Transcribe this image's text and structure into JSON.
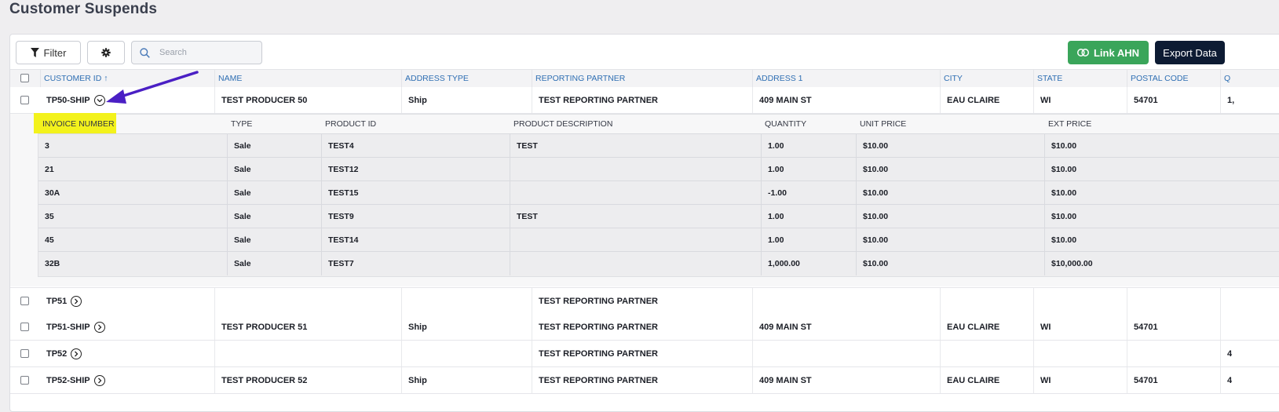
{
  "page": {
    "title": "Customer Suspends"
  },
  "toolbar": {
    "filter_label": "Filter",
    "search_placeholder": "Search",
    "link_label": "Link AHN",
    "export_label": "Export Data",
    "accent_green": "#3aa55a",
    "accent_navy": "#0d1b33"
  },
  "table": {
    "columns": [
      "CUSTOMER ID ↑",
      "NAME",
      "ADDRESS TYPE",
      "REPORTING PARTNER",
      "ADDRESS 1",
      "CITY",
      "STATE",
      "POSTAL CODE",
      "Q"
    ],
    "rows": [
      {
        "customer_id": "TP50-SHIP",
        "name": "TEST PRODUCER 50",
        "address_type": "Ship",
        "partner": "TEST REPORTING PARTNER",
        "address1": "409 MAIN ST",
        "city": "EAU CLAIRE",
        "state": "WI",
        "postal": "54701",
        "extra": "1,"
      },
      {
        "customer_id": "TP51",
        "name": "",
        "address_type": "",
        "partner": "TEST REPORTING PARTNER",
        "address1": "",
        "city": "",
        "state": "",
        "postal": "",
        "extra": ""
      },
      {
        "customer_id": "TP51-SHIP",
        "name": "TEST PRODUCER 51",
        "address_type": "Ship",
        "partner": "TEST REPORTING PARTNER",
        "address1": "409 MAIN ST",
        "city": "EAU CLAIRE",
        "state": "WI",
        "postal": "54701",
        "extra": ""
      },
      {
        "customer_id": "TP52",
        "name": "",
        "address_type": "",
        "partner": "TEST REPORTING PARTNER",
        "address1": "",
        "city": "",
        "state": "",
        "postal": "",
        "extra": "4"
      },
      {
        "customer_id": "TP52-SHIP",
        "name": "TEST PRODUCER 52",
        "address_type": "Ship",
        "partner": "TEST REPORTING PARTNER",
        "address1": "409 MAIN ST",
        "city": "EAU CLAIRE",
        "state": "WI",
        "postal": "54701",
        "extra": "4"
      }
    ]
  },
  "subtable": {
    "columns": [
      "INVOICE NUMBER",
      "TYPE",
      "PRODUCT ID",
      "PRODUCT DESCRIPTION",
      "QUANTITY",
      "UNIT PRICE",
      "EXT PRICE"
    ],
    "rows": [
      [
        "3",
        "Sale",
        "TEST4",
        "TEST",
        "1.00",
        "$10.00",
        "$10.00"
      ],
      [
        "21",
        "Sale",
        "TEST12",
        "",
        "1.00",
        "$10.00",
        "$10.00"
      ],
      [
        "30A",
        "Sale",
        "TEST15",
        "",
        "-1.00",
        "$10.00",
        "$10.00"
      ],
      [
        "35",
        "Sale",
        "TEST9",
        "TEST",
        "1.00",
        "$10.00",
        "$10.00"
      ],
      [
        "45",
        "Sale",
        "TEST14",
        "",
        "1.00",
        "$10.00",
        "$10.00"
      ],
      [
        "32B",
        "Sale",
        "TEST7",
        "",
        "1,000.00",
        "$10.00",
        "$10,000.00"
      ]
    ],
    "highlight_color": "#f3f21c"
  },
  "annotation": {
    "arrow_color": "#4a1fc4"
  }
}
